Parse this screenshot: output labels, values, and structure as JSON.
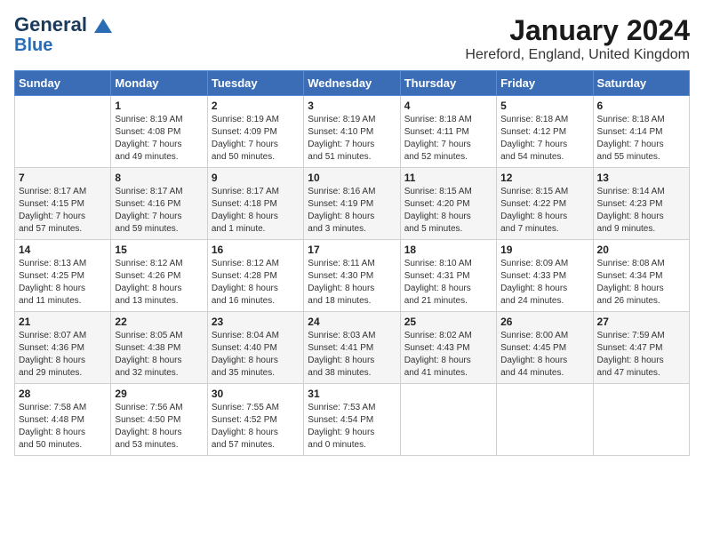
{
  "header": {
    "logo_line1": "General",
    "logo_line2": "Blue",
    "title": "January 2024",
    "subtitle": "Hereford, England, United Kingdom"
  },
  "days_of_week": [
    "Sunday",
    "Monday",
    "Tuesday",
    "Wednesday",
    "Thursday",
    "Friday",
    "Saturday"
  ],
  "weeks": [
    [
      {
        "day": "",
        "text": ""
      },
      {
        "day": "1",
        "text": "Sunrise: 8:19 AM\nSunset: 4:08 PM\nDaylight: 7 hours\nand 49 minutes."
      },
      {
        "day": "2",
        "text": "Sunrise: 8:19 AM\nSunset: 4:09 PM\nDaylight: 7 hours\nand 50 minutes."
      },
      {
        "day": "3",
        "text": "Sunrise: 8:19 AM\nSunset: 4:10 PM\nDaylight: 7 hours\nand 51 minutes."
      },
      {
        "day": "4",
        "text": "Sunrise: 8:18 AM\nSunset: 4:11 PM\nDaylight: 7 hours\nand 52 minutes."
      },
      {
        "day": "5",
        "text": "Sunrise: 8:18 AM\nSunset: 4:12 PM\nDaylight: 7 hours\nand 54 minutes."
      },
      {
        "day": "6",
        "text": "Sunrise: 8:18 AM\nSunset: 4:14 PM\nDaylight: 7 hours\nand 55 minutes."
      }
    ],
    [
      {
        "day": "7",
        "text": "Sunrise: 8:17 AM\nSunset: 4:15 PM\nDaylight: 7 hours\nand 57 minutes."
      },
      {
        "day": "8",
        "text": "Sunrise: 8:17 AM\nSunset: 4:16 PM\nDaylight: 7 hours\nand 59 minutes."
      },
      {
        "day": "9",
        "text": "Sunrise: 8:17 AM\nSunset: 4:18 PM\nDaylight: 8 hours\nand 1 minute."
      },
      {
        "day": "10",
        "text": "Sunrise: 8:16 AM\nSunset: 4:19 PM\nDaylight: 8 hours\nand 3 minutes."
      },
      {
        "day": "11",
        "text": "Sunrise: 8:15 AM\nSunset: 4:20 PM\nDaylight: 8 hours\nand 5 minutes."
      },
      {
        "day": "12",
        "text": "Sunrise: 8:15 AM\nSunset: 4:22 PM\nDaylight: 8 hours\nand 7 minutes."
      },
      {
        "day": "13",
        "text": "Sunrise: 8:14 AM\nSunset: 4:23 PM\nDaylight: 8 hours\nand 9 minutes."
      }
    ],
    [
      {
        "day": "14",
        "text": "Sunrise: 8:13 AM\nSunset: 4:25 PM\nDaylight: 8 hours\nand 11 minutes."
      },
      {
        "day": "15",
        "text": "Sunrise: 8:12 AM\nSunset: 4:26 PM\nDaylight: 8 hours\nand 13 minutes."
      },
      {
        "day": "16",
        "text": "Sunrise: 8:12 AM\nSunset: 4:28 PM\nDaylight: 8 hours\nand 16 minutes."
      },
      {
        "day": "17",
        "text": "Sunrise: 8:11 AM\nSunset: 4:30 PM\nDaylight: 8 hours\nand 18 minutes."
      },
      {
        "day": "18",
        "text": "Sunrise: 8:10 AM\nSunset: 4:31 PM\nDaylight: 8 hours\nand 21 minutes."
      },
      {
        "day": "19",
        "text": "Sunrise: 8:09 AM\nSunset: 4:33 PM\nDaylight: 8 hours\nand 24 minutes."
      },
      {
        "day": "20",
        "text": "Sunrise: 8:08 AM\nSunset: 4:34 PM\nDaylight: 8 hours\nand 26 minutes."
      }
    ],
    [
      {
        "day": "21",
        "text": "Sunrise: 8:07 AM\nSunset: 4:36 PM\nDaylight: 8 hours\nand 29 minutes."
      },
      {
        "day": "22",
        "text": "Sunrise: 8:05 AM\nSunset: 4:38 PM\nDaylight: 8 hours\nand 32 minutes."
      },
      {
        "day": "23",
        "text": "Sunrise: 8:04 AM\nSunset: 4:40 PM\nDaylight: 8 hours\nand 35 minutes."
      },
      {
        "day": "24",
        "text": "Sunrise: 8:03 AM\nSunset: 4:41 PM\nDaylight: 8 hours\nand 38 minutes."
      },
      {
        "day": "25",
        "text": "Sunrise: 8:02 AM\nSunset: 4:43 PM\nDaylight: 8 hours\nand 41 minutes."
      },
      {
        "day": "26",
        "text": "Sunrise: 8:00 AM\nSunset: 4:45 PM\nDaylight: 8 hours\nand 44 minutes."
      },
      {
        "day": "27",
        "text": "Sunrise: 7:59 AM\nSunset: 4:47 PM\nDaylight: 8 hours\nand 47 minutes."
      }
    ],
    [
      {
        "day": "28",
        "text": "Sunrise: 7:58 AM\nSunset: 4:48 PM\nDaylight: 8 hours\nand 50 minutes."
      },
      {
        "day": "29",
        "text": "Sunrise: 7:56 AM\nSunset: 4:50 PM\nDaylight: 8 hours\nand 53 minutes."
      },
      {
        "day": "30",
        "text": "Sunrise: 7:55 AM\nSunset: 4:52 PM\nDaylight: 8 hours\nand 57 minutes."
      },
      {
        "day": "31",
        "text": "Sunrise: 7:53 AM\nSunset: 4:54 PM\nDaylight: 9 hours\nand 0 minutes."
      },
      {
        "day": "",
        "text": ""
      },
      {
        "day": "",
        "text": ""
      },
      {
        "day": "",
        "text": ""
      }
    ]
  ]
}
